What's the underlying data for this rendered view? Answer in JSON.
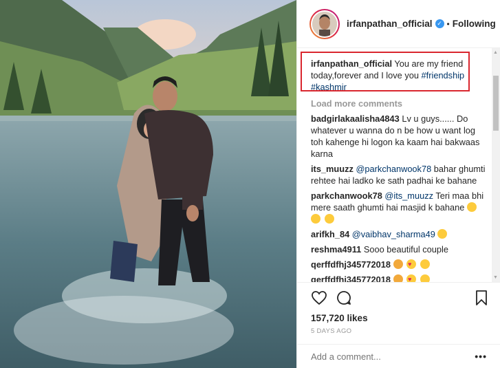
{
  "header": {
    "username": "irfanpathan_official",
    "verified_icon": "verified-badge-icon",
    "separator": "•",
    "follow_label": "Following"
  },
  "caption": {
    "username": "irfanpathan_official",
    "text": "You are my friend today,forever and I love you",
    "hashtags": [
      "#friendship",
      "#kashmir"
    ]
  },
  "load_more": "Load more comments",
  "comments": [
    {
      "user": "badgirlakaalisha4843",
      "text": "Lv u guys...... Do whatever u wanna do n be how u want log toh kahenge hi logon ka kaam hai bakwaas karna"
    },
    {
      "user": "its_muuzz",
      "mention": "@parkchanwook78",
      "text": "bahar ghumti rehtee hai ladko ke sath padhai ke bahane"
    },
    {
      "user": "parkchanwook78",
      "mention": "@its_muuzz",
      "text": "Teri maa bhi mere saath ghumti hai masjid k bahane",
      "emojis": [
        "laughing",
        "laughing",
        "laughing"
      ]
    },
    {
      "user": "arifkh_84",
      "mention": "@vaibhav_sharma49",
      "text": "",
      "emojis": [
        "laughing"
      ]
    },
    {
      "user": "reshma4911",
      "text": "Sooo beautiful couple"
    },
    {
      "user": "qerffdfhj345772018",
      "text": "",
      "emojis": [
        "cat-heart-eyes",
        "heart-eyes",
        "smile"
      ]
    },
    {
      "user": "qerffdfhj345772018",
      "text": "",
      "emojis": [
        "cat-heart-eyes",
        "heart-eyes",
        "smile"
      ]
    }
  ],
  "likes": "157,720 likes",
  "time": "5 DAYS AGO",
  "add_comment": {
    "placeholder": "Add a comment..."
  },
  "more_options": "•••",
  "colors": {
    "link": "#003569",
    "muted": "#999999",
    "highlight_border": "#d9262e",
    "verified": "#3897f0"
  }
}
